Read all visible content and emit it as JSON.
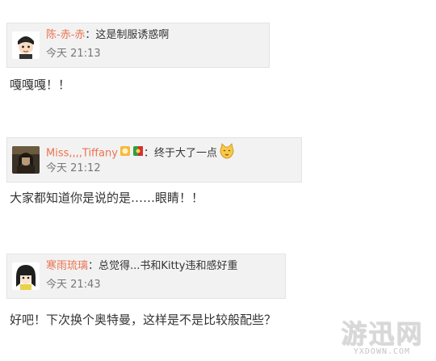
{
  "comments": [
    {
      "username": "陈-赤-赤",
      "separator": "：",
      "text": "这是制服诱惑啊",
      "time": "今天 21:13",
      "avatar_icon": "cartoon-boy-avatar"
    },
    {
      "username": "Miss,,,,Tiffany",
      "separator": "：",
      "text": "终于大了一点",
      "time": "今天 21:12",
      "avatar_icon": "dark-photo-avatar"
    },
    {
      "username": "寒雨琉璃",
      "separator": "：",
      "text": "总觉得...书和Kitty违和感好重",
      "time": "今天 21:43",
      "avatar_icon": "anime-girl-avatar"
    }
  ],
  "posts": [
    "嘎嘎嘎！！",
    "大家都知道你是说的是……眼睛！！",
    "好吧！下次换个奥特曼，这样是不是比较般配些？"
  ],
  "watermark": {
    "logo": "游迅网",
    "url": "YXDOWN.COM"
  },
  "colors": {
    "username": "#eb7350",
    "card_bg": "#f2f2f2",
    "time": "#777777"
  }
}
